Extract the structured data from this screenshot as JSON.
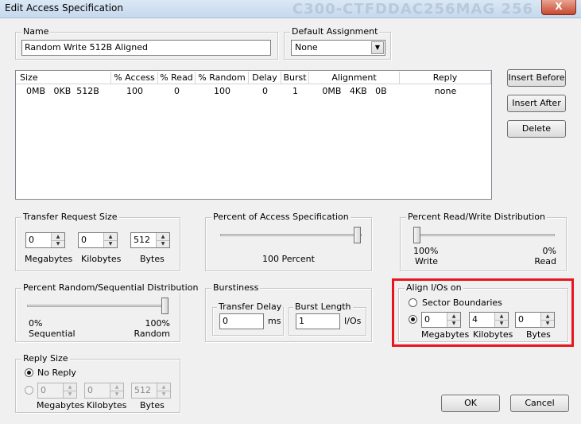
{
  "window": {
    "title": "Edit Access Specification",
    "bg_text": "C300-CTFDDAC256MAG 256",
    "close_label": "X"
  },
  "name_group": {
    "legend": "Name",
    "value": "Random Write 512B Aligned"
  },
  "default_assignment": {
    "legend": "Default Assignment",
    "value": "None"
  },
  "table": {
    "headers": [
      "Size",
      "% Access",
      "% Read",
      "% Random",
      "Delay",
      "Burst",
      "Alignment",
      "Reply"
    ],
    "rows": [
      [
        "0MB   0KB  512B",
        "100",
        "0",
        "100",
        "0",
        "1",
        "0MB   4KB   0B",
        "none"
      ]
    ]
  },
  "buttons": {
    "insert_before": "Insert Before",
    "insert_after": "Insert After",
    "delete": "Delete",
    "ok": "OK",
    "cancel": "Cancel"
  },
  "transfer_request_size": {
    "legend": "Transfer Request Size",
    "megabytes": "0",
    "kilobytes": "0",
    "bytes": "512",
    "label_megabytes": "Megabytes",
    "label_kilobytes": "Kilobytes",
    "label_bytes": "Bytes"
  },
  "percent_access": {
    "legend": "Percent of Access Specification",
    "value_label": "100 Percent",
    "value": 100
  },
  "percent_read_write": {
    "legend": "Percent Read/Write Distribution",
    "left_pct": "100%",
    "left_label": "Write",
    "right_pct": "0%",
    "right_label": "Read",
    "read_value": 0
  },
  "percent_random": {
    "legend": "Percent Random/Sequential Distribution",
    "left_pct": "0%",
    "left_label": "Sequential",
    "right_pct": "100%",
    "right_label": "Random",
    "random_value": 100
  },
  "burstiness": {
    "legend": "Burstiness",
    "transfer_delay_legend": "Transfer Delay",
    "transfer_delay_value": "0",
    "transfer_delay_unit": "ms",
    "burst_length_legend": "Burst Length",
    "burst_length_value": "1",
    "burst_length_unit": "I/Os"
  },
  "align": {
    "legend": "Align I/Os on",
    "sector_boundaries": "Sector Boundaries",
    "megabytes": "0",
    "kilobytes": "4",
    "bytes": "0",
    "label_megabytes": "Megabytes",
    "label_kilobytes": "Kilobytes",
    "label_bytes": "Bytes"
  },
  "reply_size": {
    "legend": "Reply Size",
    "no_reply": "No Reply",
    "megabytes": "0",
    "kilobytes": "0",
    "bytes": "512",
    "label_megabytes": "Megabytes",
    "label_kilobytes": "Kilobytes",
    "label_bytes": "Bytes"
  },
  "colors": {
    "highlight": "#e6161e",
    "window_bg": "#f0f0f0"
  },
  "icons": {
    "spin_up": "arrow-up-icon",
    "spin_down": "arrow-down-icon",
    "dropdown": "chevron-down-icon"
  }
}
